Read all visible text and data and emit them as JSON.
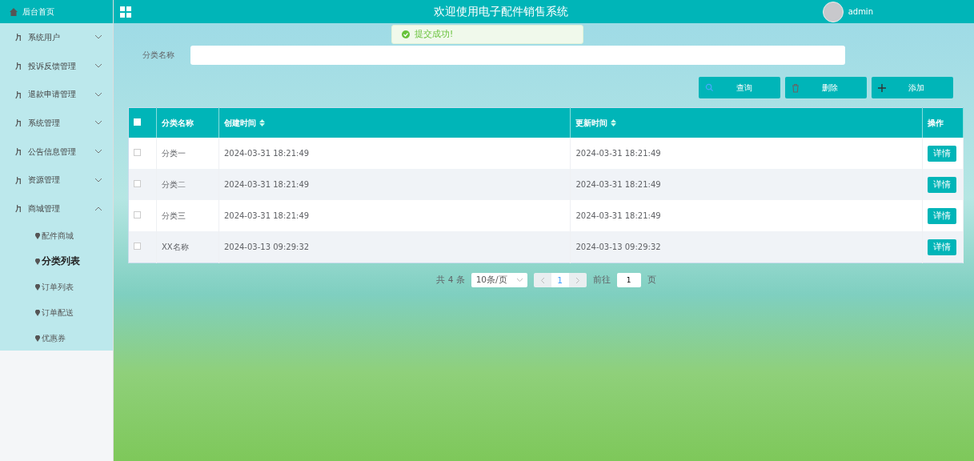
{
  "header": {
    "title": "欢迎使用电子配件销售系统",
    "user": "admin"
  },
  "toast": {
    "message": "提交成功!"
  },
  "sidebar": {
    "home": "后台首页",
    "items": [
      {
        "label": "系统用户",
        "expanded": false
      },
      {
        "label": "投诉反馈管理",
        "expanded": false
      },
      {
        "label": "退款申请管理",
        "expanded": false
      },
      {
        "label": "系统管理",
        "expanded": false
      },
      {
        "label": "公告信息管理",
        "expanded": false
      },
      {
        "label": "资源管理",
        "expanded": false
      },
      {
        "label": "商城管理",
        "expanded": true,
        "children": [
          {
            "label": "配件商城",
            "selected": false
          },
          {
            "label": "分类列表",
            "selected": true
          },
          {
            "label": "订单列表",
            "selected": false
          },
          {
            "label": "订单配送",
            "selected": false
          },
          {
            "label": "优惠券",
            "selected": false
          }
        ]
      }
    ]
  },
  "search": {
    "label": "分类名称"
  },
  "buttons": [
    {
      "label": "查询",
      "kind": "search"
    },
    {
      "label": "删除",
      "kind": "delete"
    },
    {
      "label": "添加",
      "kind": "add"
    }
  ],
  "table": {
    "all_checked": false,
    "columns": [
      {
        "label": "分类名称",
        "sortable": false
      },
      {
        "label": "创建时间",
        "sortable": true
      },
      {
        "label": "更新时间",
        "sortable": true
      },
      {
        "label": "操作",
        "sortable": false
      }
    ],
    "rows": [
      {
        "checked": false,
        "cells": [
          "分类一",
          "2024-03-31 18:21:49",
          "2024-03-31 18:21:49"
        ],
        "action": "详情"
      },
      {
        "checked": false,
        "cells": [
          "分类二",
          "2024-03-31 18:21:49",
          "2024-03-31 18:21:49"
        ],
        "action": "详情"
      },
      {
        "checked": false,
        "cells": [
          "分类三",
          "2024-03-31 18:21:49",
          "2024-03-31 18:21:49"
        ],
        "action": "详情"
      },
      {
        "checked": false,
        "cells": [
          "XX名称",
          "2024-03-13 09:29:32",
          "2024-03-13 09:29:32"
        ],
        "action": "详情"
      }
    ]
  },
  "pagination": {
    "total": "共 4 条",
    "page_size": "10条/页",
    "pages": [
      {
        "label": "1",
        "selected": true
      }
    ],
    "goto_label": "前往",
    "goto_value": "1",
    "goto_suffix": "页"
  }
}
